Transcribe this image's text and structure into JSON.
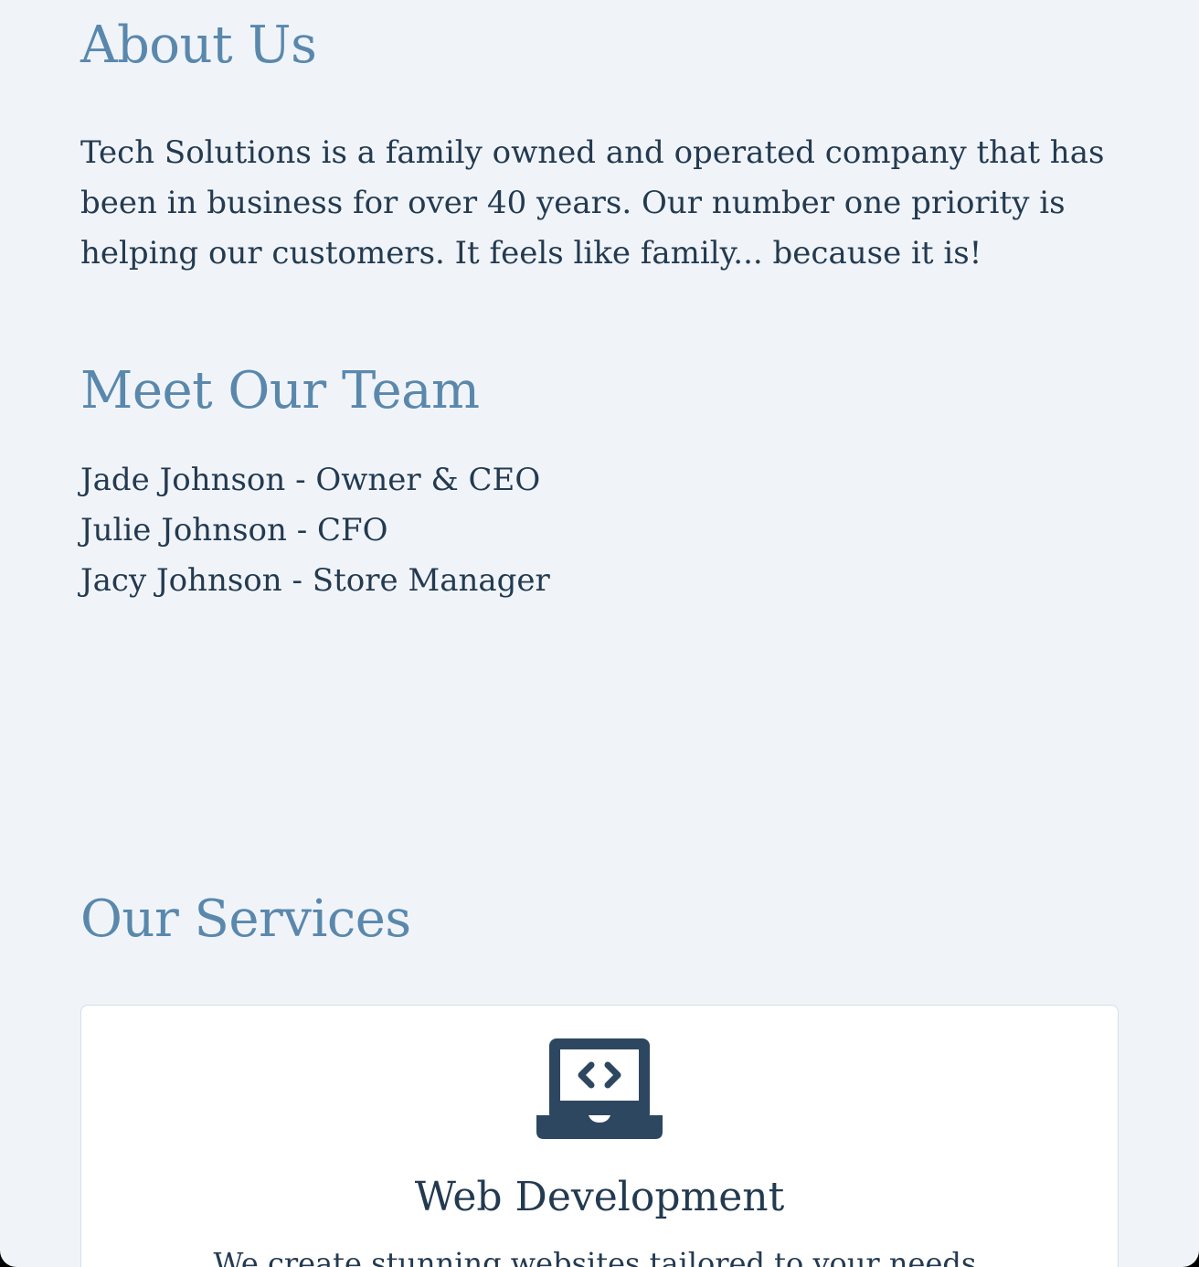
{
  "about": {
    "heading": "About Us",
    "body": "Tech Solutions is a family owned and operated company that has been in business for over 40 years. Our number one priority is helping our customers. It feels like family... because it is!"
  },
  "team": {
    "heading": "Meet Our Team",
    "members": [
      "Jade Johnson - Owner & CEO",
      "Julie Johnson - CFO",
      "Jacy Johnson - Store Manager"
    ]
  },
  "services": {
    "heading": "Our Services",
    "cards": [
      {
        "icon": "laptop-code-icon",
        "title": "Web Development",
        "description": "We create stunning websites tailored to your needs."
      }
    ]
  },
  "colors": {
    "background": "#f0f4f9",
    "heading": "#5a88ad",
    "text": "#233a50",
    "icon": "#2d4761"
  }
}
